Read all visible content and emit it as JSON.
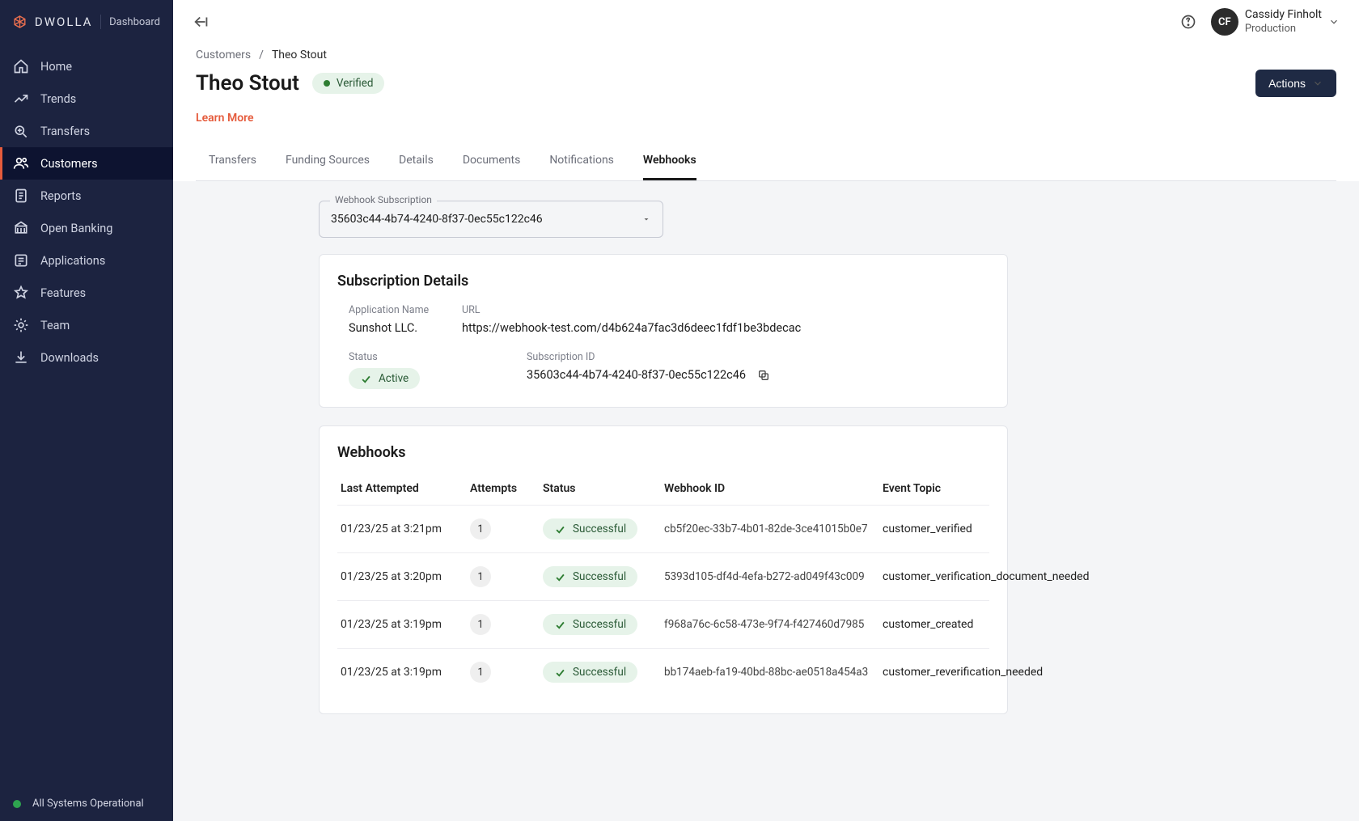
{
  "brand": {
    "name": "DWOLLA",
    "sublabel": "Dashboard"
  },
  "sidebar": {
    "items": [
      {
        "label": "Home",
        "icon": "home-icon"
      },
      {
        "label": "Trends",
        "icon": "trends-icon"
      },
      {
        "label": "Transfers",
        "icon": "transfers-icon"
      },
      {
        "label": "Customers",
        "icon": "customers-icon",
        "active": true
      },
      {
        "label": "Reports",
        "icon": "reports-icon"
      },
      {
        "label": "Open Banking",
        "icon": "open-banking-icon"
      },
      {
        "label": "Applications",
        "icon": "applications-icon"
      },
      {
        "label": "Features",
        "icon": "features-icon"
      },
      {
        "label": "Team",
        "icon": "team-icon"
      },
      {
        "label": "Downloads",
        "icon": "downloads-icon"
      }
    ],
    "status": "All Systems Operational"
  },
  "user": {
    "initials": "CF",
    "name": "Cassidy Finholt",
    "env": "Production"
  },
  "breadcrumb": {
    "root": "Customers",
    "sep": "/",
    "current": "Theo Stout"
  },
  "page": {
    "title": "Theo Stout",
    "verified_label": "Verified",
    "learn_more": "Learn More",
    "actions_label": "Actions"
  },
  "tabs": [
    {
      "label": "Transfers"
    },
    {
      "label": "Funding Sources"
    },
    {
      "label": "Details"
    },
    {
      "label": "Documents"
    },
    {
      "label": "Notifications"
    },
    {
      "label": "Webhooks",
      "active": true
    }
  ],
  "subscription_picker": {
    "label": "Webhook Subscription",
    "value": "35603c44-4b74-4240-8f37-0ec55c122c46"
  },
  "subscription_details": {
    "heading": "Subscription Details",
    "app_label": "Application Name",
    "app": "Sunshot LLC.",
    "url_label": "URL",
    "url": "https://webhook-test.com/d4b624a7fac3d6deec1fdf1be3bdecac",
    "status_label": "Status",
    "status": "Active",
    "id_label": "Subscription ID",
    "id": "35603c44-4b74-4240-8f37-0ec55c122c46"
  },
  "webhooks": {
    "heading": "Webhooks",
    "cols": {
      "last": "Last Attempted",
      "attempts": "Attempts",
      "status": "Status",
      "id": "Webhook ID",
      "topic": "Event Topic"
    },
    "rows": [
      {
        "last": "01/23/25 at 3:21pm",
        "attempts": "1",
        "status": "Successful",
        "id": "cb5f20ec-33b7-4b01-82de-3ce41015b0e7",
        "topic": "customer_verified"
      },
      {
        "last": "01/23/25 at 3:20pm",
        "attempts": "1",
        "status": "Successful",
        "id": "5393d105-df4d-4efa-b272-ad049f43c009",
        "topic": "customer_verification_document_needed"
      },
      {
        "last": "01/23/25 at 3:19pm",
        "attempts": "1",
        "status": "Successful",
        "id": "f968a76c-6c58-473e-9f74-f427460d7985",
        "topic": "customer_created"
      },
      {
        "last": "01/23/25 at 3:19pm",
        "attempts": "1",
        "status": "Successful",
        "id": "bb174aeb-fa19-40bd-88bc-ae0518a454a3",
        "topic": "customer_reverification_needed"
      }
    ]
  }
}
